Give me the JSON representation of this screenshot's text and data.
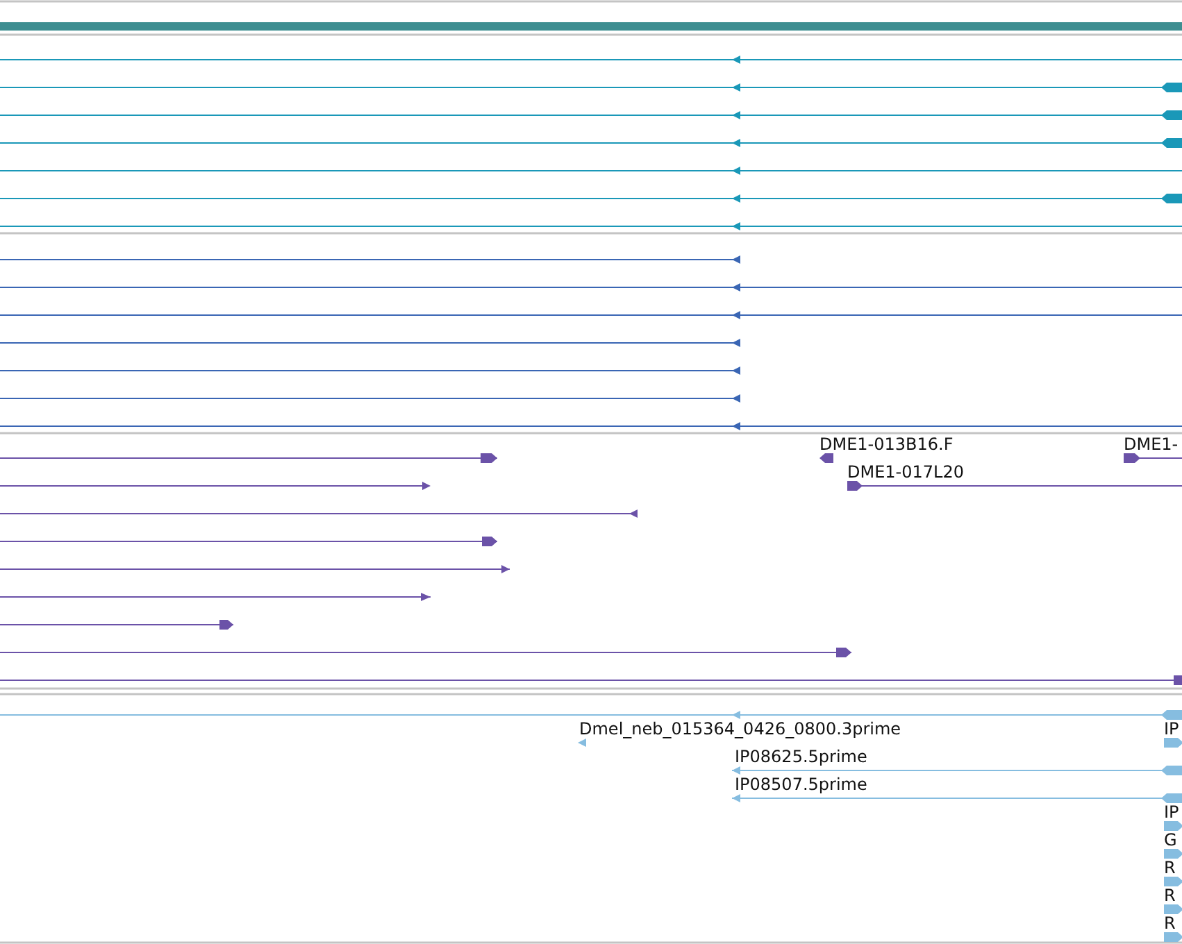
{
  "tracks": [
    {
      "color": "#1a98b8",
      "rows": [
        {
          "features": [
            {
              "reverse": true
            }
          ]
        },
        {
          "features": [
            {
              "reverse": true
            }
          ]
        },
        {
          "features": [
            {
              "reverse": true
            }
          ]
        },
        {
          "features": [
            {
              "reverse": true
            }
          ]
        },
        {
          "features": [
            {
              "reverse": true
            }
          ]
        },
        {
          "features": [
            {
              "reverse": true
            }
          ]
        },
        {
          "features": [
            {
              "reverse": true
            }
          ]
        }
      ]
    },
    {
      "color": "#3a66b4",
      "rows": [
        {
          "features": [
            {
              "reverse": true
            }
          ]
        },
        {
          "features": [
            {
              "reverse": true
            }
          ]
        },
        {
          "features": [
            {
              "reverse": true
            }
          ]
        },
        {
          "features": [
            {
              "reverse": true
            }
          ]
        },
        {
          "features": [
            {
              "reverse": true
            }
          ]
        },
        {
          "features": [
            {
              "reverse": true
            }
          ]
        },
        {
          "features": [
            {
              "reverse": true
            }
          ]
        }
      ]
    },
    {
      "color": "#6b52a8",
      "rows": [
        {
          "features": [
            {
              "reverse": false
            },
            {
              "reverse": true,
              "label": "DME1-013B16.F"
            },
            {
              "reverse": false,
              "label": "DME1-"
            }
          ]
        },
        {
          "features": [
            {
              "reverse": false
            },
            {
              "reverse": false,
              "label": "DME1-017L20"
            }
          ]
        },
        {
          "features": [
            {
              "reverse": true
            }
          ]
        },
        {
          "features": [
            {
              "reverse": false
            }
          ]
        },
        {
          "features": [
            {
              "reverse": false
            }
          ]
        },
        {
          "features": [
            {
              "reverse": false
            }
          ]
        },
        {
          "features": [
            {
              "reverse": false
            }
          ]
        },
        {
          "features": [
            {
              "reverse": false
            }
          ]
        },
        {
          "features": [
            {
              "kind": "block"
            }
          ]
        }
      ]
    },
    {
      "color": "#86bde0",
      "rows": [
        {
          "features": [
            {
              "reverse": true
            }
          ]
        },
        {
          "features": [
            {
              "reverse": true,
              "label": "Dmel_neb_015364_0426_0800.3prime"
            },
            {
              "reverse": false,
              "label": "IP"
            }
          ]
        },
        {
          "features": [
            {
              "reverse": true,
              "label": "IP08625.5prime"
            }
          ]
        },
        {
          "features": [
            {
              "reverse": true,
              "label": "IP08507.5prime"
            }
          ]
        },
        {
          "features": [
            {
              "reverse": false,
              "label": "IP"
            }
          ]
        },
        {
          "features": [
            {
              "reverse": false,
              "label": "G"
            }
          ]
        },
        {
          "features": [
            {
              "reverse": false,
              "label": "R"
            }
          ]
        },
        {
          "features": [
            {
              "reverse": false,
              "label": "R"
            }
          ]
        },
        {
          "features": [
            {
              "reverse": false,
              "label": "R"
            }
          ]
        }
      ]
    }
  ]
}
